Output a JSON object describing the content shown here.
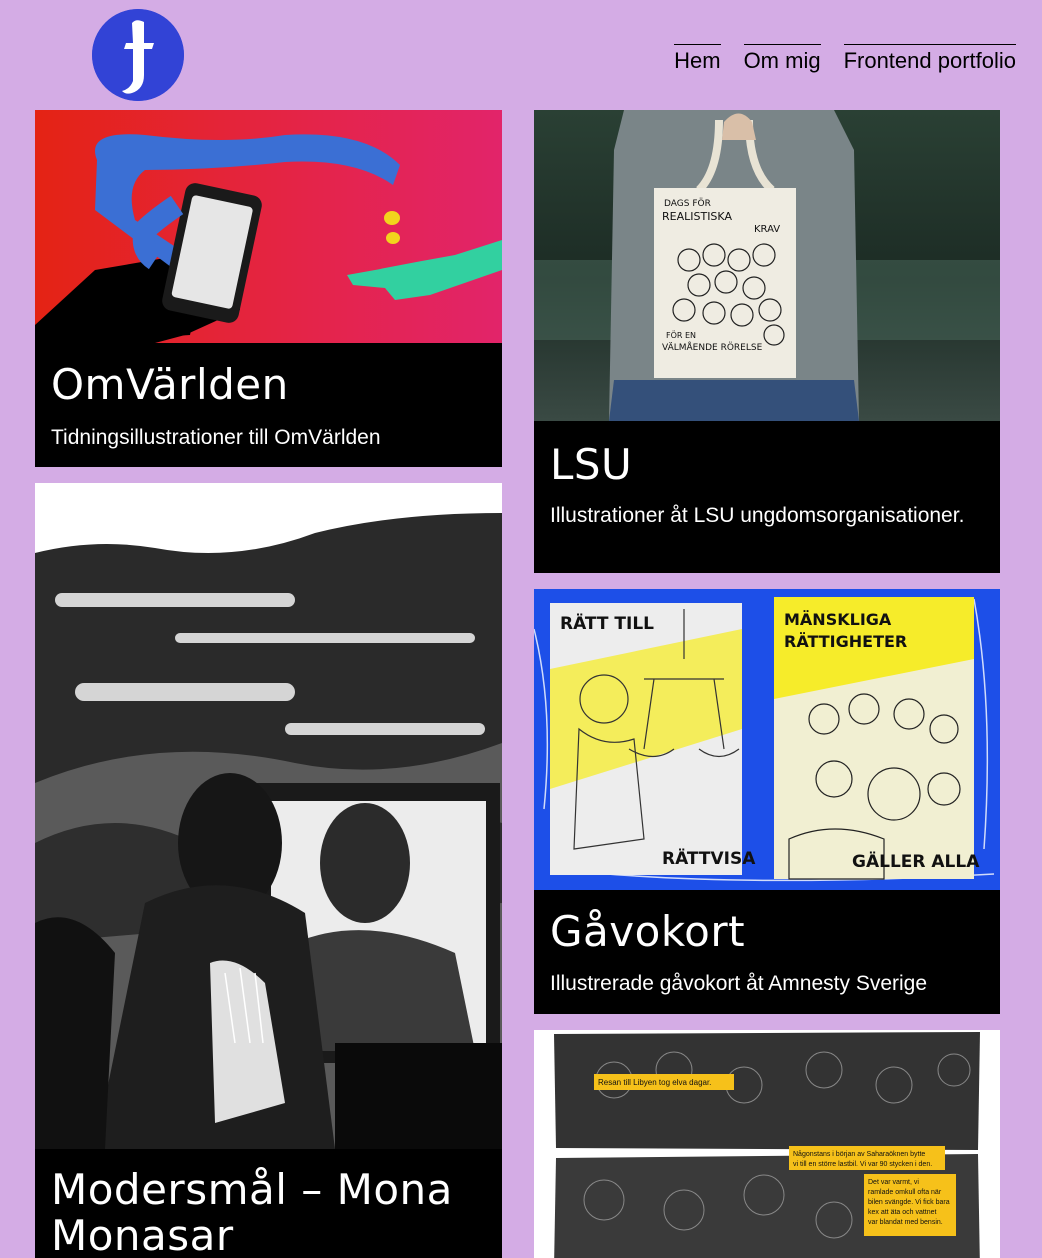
{
  "nav": {
    "logo_label": "j",
    "items": [
      {
        "label": "Hem"
      },
      {
        "label": "Om mig"
      },
      {
        "label": "Frontend portfolio"
      }
    ]
  },
  "projects": [
    {
      "title": "OmVärlden",
      "description": "Tidningsillustrationer till OmVärlden",
      "image": "phone-hands-illustration"
    },
    {
      "title": "LSU",
      "description": "Illustrationer åt LSU ungdomsorganisationer.",
      "image": "tote-bag-photo"
    },
    {
      "title": "Gåvokort",
      "description": "Illustrerade gåvokort åt Amnesty Sverige",
      "image": "gift-cards-illustration"
    },
    {
      "title": "Modersmål – Mona Monasar",
      "description": "",
      "image": "mirror-portrait-illustration"
    },
    {
      "title": "",
      "description": "",
      "image": "comic-strip-illustration"
    }
  ],
  "art_text": {
    "tote_line1": "DAGS FÖR",
    "tote_line2": "REALISTISKA",
    "tote_line3": "KRAV",
    "tote_line4": "FÖR EN",
    "tote_line5": "VÄLMÅENDE RÖRELSE",
    "card_left_top": "RÄTT TILL",
    "card_left_bottom": "RÄTTVISA",
    "card_right_top1": "MÄNSKLIGA",
    "card_right_top2": "RÄTTIGHETER",
    "card_right_bottom": "GÄLLER ALLA",
    "comic_caption1": "Resan till Libyen tog elva dagar.",
    "comic_caption2a": "Någonstans i början av Saharaöknen bytte",
    "comic_caption2b": "vi till en större lastbil. Vi var 90 stycken i den.",
    "comic_caption3a": "Det var varmt, vi",
    "comic_caption3b": "ramlade omkull ofta när",
    "comic_caption3c": "bilen svängde. Vi fick bara",
    "comic_caption3d": "kex att äta och vattnet",
    "comic_caption3e": "var blandat med bensin."
  },
  "colors": {
    "background": "#d4ace5",
    "logo": "#3243d6",
    "card": "#000000",
    "card_text": "#ffffff",
    "accent_yellow": "#f6ec2a",
    "accent_blue": "#1d4fe8"
  }
}
